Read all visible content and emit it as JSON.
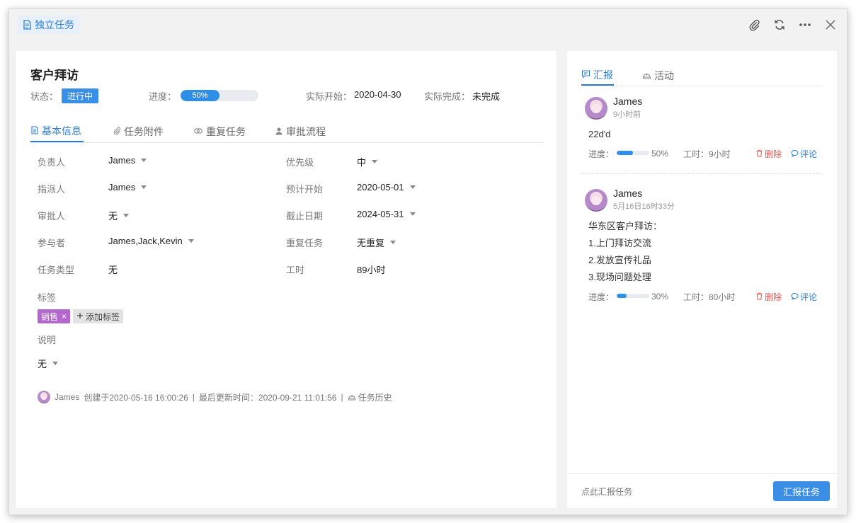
{
  "header": {
    "task_type": "独立任务",
    "icons": [
      "attachment-icon",
      "refresh-icon",
      "more-icon",
      "close-icon"
    ]
  },
  "task": {
    "title": "客户拜访",
    "status_label": "状态：",
    "status_value": "进行中",
    "progress_label": "进度：",
    "progress_text": "50%",
    "progress_value": 50,
    "actual_start_label": "实际开始：",
    "actual_start_value": "2020-04-30",
    "actual_finish_label": "实际完成：",
    "actual_finish_value": "未完成"
  },
  "tabs": [
    {
      "label": "基本信息",
      "icon": "document-icon",
      "active": true
    },
    {
      "label": "任务附件",
      "icon": "paperclip-icon",
      "active": false
    },
    {
      "label": "重复任务",
      "icon": "repeat-icon",
      "active": false
    },
    {
      "label": "审批流程",
      "icon": "user-icon",
      "active": false
    }
  ],
  "fields": {
    "owner": {
      "label": "负责人",
      "value": "James"
    },
    "priority": {
      "label": "优先级",
      "value": "中"
    },
    "assigner": {
      "label": "指派人",
      "value": "James"
    },
    "planned_start": {
      "label": "预计开始",
      "value": "2020-05-01"
    },
    "approver": {
      "label": "审批人",
      "value": "无"
    },
    "deadline": {
      "label": "截止日期",
      "value": "2024-05-31"
    },
    "participants": {
      "label": "参与者",
      "value": "James,Jack,Kevin"
    },
    "repeat": {
      "label": "重复任务",
      "value": "无重复"
    },
    "task_type": {
      "label": "任务类型",
      "value": "无"
    },
    "hours": {
      "label": "工时",
      "value": "89小时"
    }
  },
  "tags": {
    "label": "标签",
    "items": [
      {
        "text": "销售",
        "color": "#b567d0"
      }
    ],
    "remove_symbol": "×",
    "add_label": "添加标签"
  },
  "description": {
    "label": "说明",
    "value": "无"
  },
  "footer_meta": {
    "user": "James",
    "created": "创建于2020-05-16 16:00:26",
    "sep1": "|",
    "updated": "最后更新时间：2020-09-21 11:01:56",
    "sep2": "|",
    "history": "任务历史"
  },
  "right_tabs": [
    {
      "label": "汇报",
      "icon": "comment-icon",
      "active": true
    },
    {
      "label": "活动",
      "icon": "activity-icon",
      "active": false
    }
  ],
  "reports": [
    {
      "user": "James",
      "time": "9小时前",
      "lines": [
        "22d'd"
      ],
      "progress_label": "进度：",
      "progress_value": 50,
      "progress_text": "50%",
      "hours": "工时：9小时",
      "delete_label": "删除",
      "comment_label": "评论"
    },
    {
      "user": "James",
      "time": "5月16日16时33分",
      "lines": [
        "华东区客户拜访：",
        "1.上门拜访交流",
        "2.发放宣传礼品",
        "3.现场问题处理"
      ],
      "progress_label": "进度：",
      "progress_value": 30,
      "progress_text": "30%",
      "hours": "工时：80小时",
      "delete_label": "删除",
      "comment_label": "评论"
    }
  ],
  "right_footer": {
    "hint": "点此汇报任务",
    "button": "汇报任务"
  },
  "colors": {
    "accent": "#2b7cd3",
    "status_badge": "#3a8ee6",
    "delete": "#e8524a",
    "tag_sales": "#b567d0"
  }
}
